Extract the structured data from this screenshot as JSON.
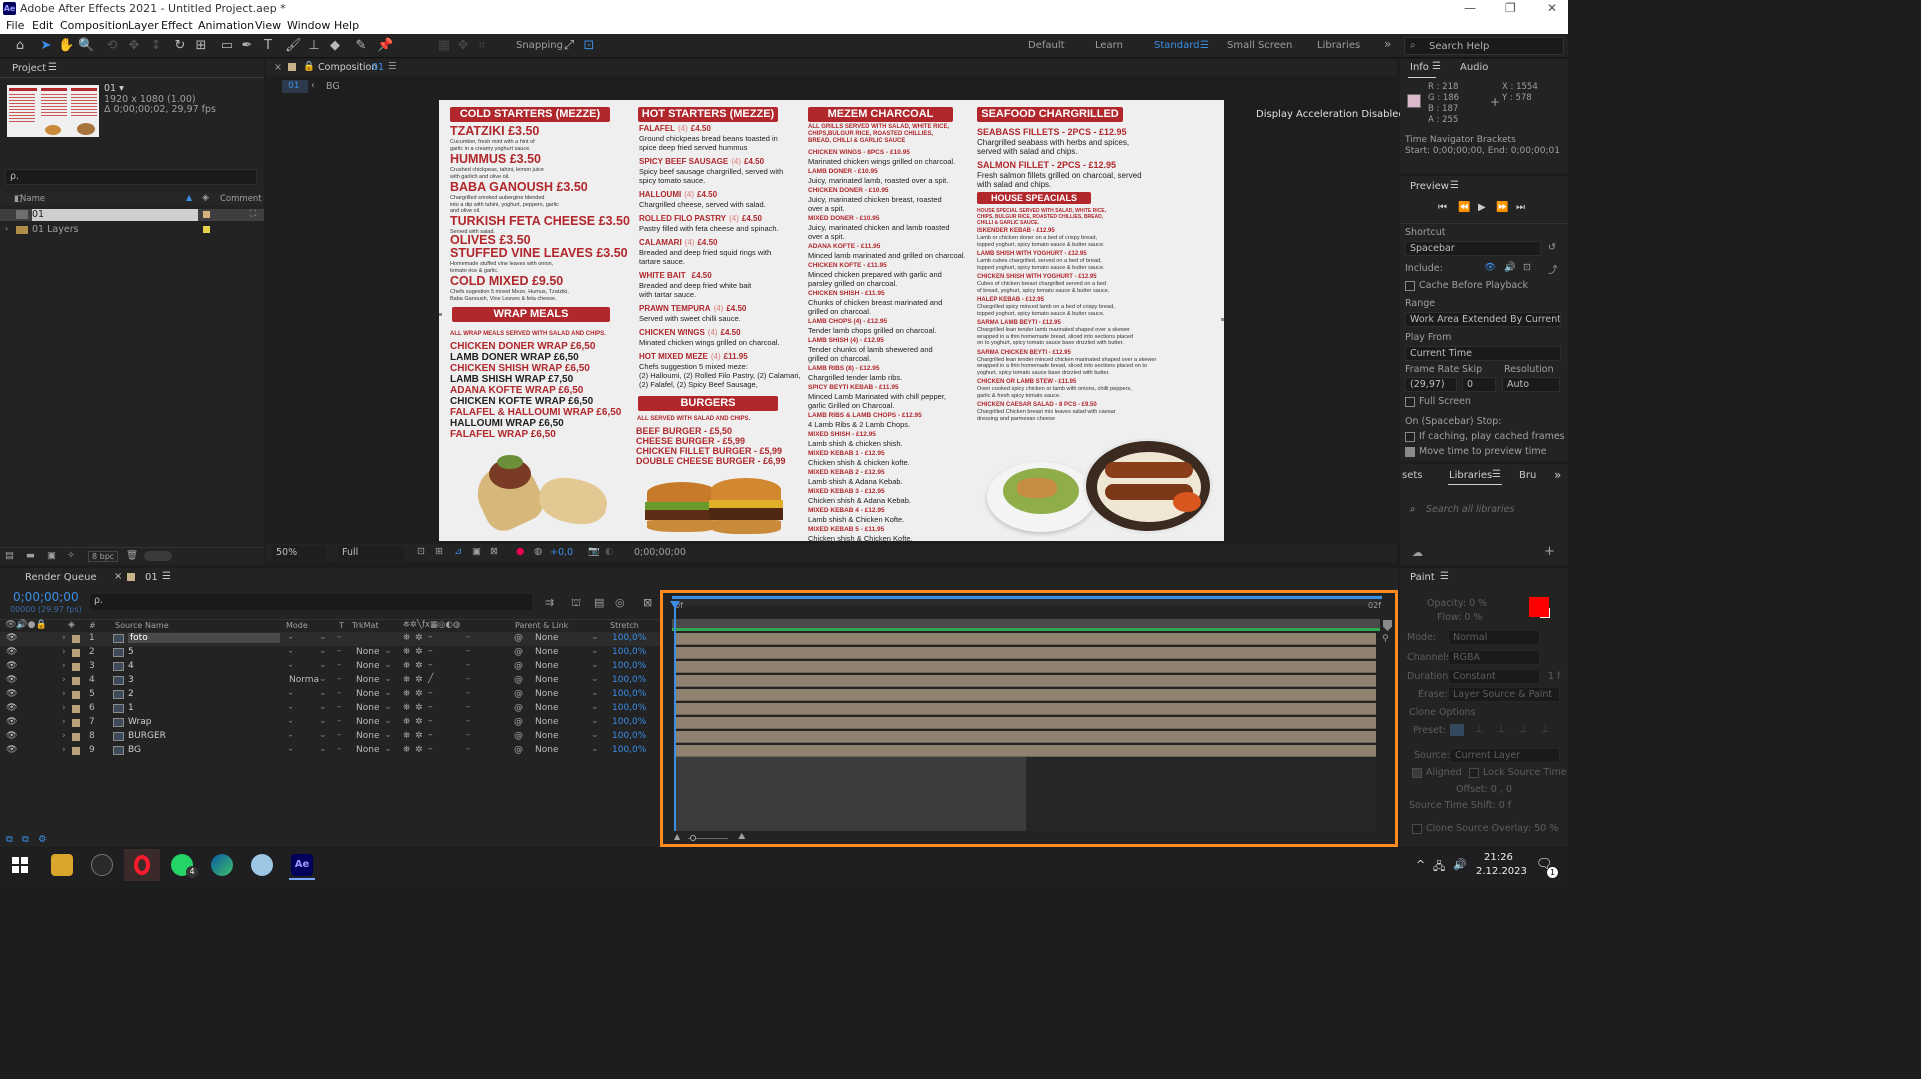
{
  "app": {
    "title": "Adobe After Effects 2021 - Untitled Project.aep *",
    "icon_text": "Ae"
  },
  "menu": [
    "File",
    "Edit",
    "Composition",
    "Layer",
    "Effect",
    "Animation",
    "View",
    "Window",
    "Help"
  ],
  "toolbar": {
    "snapping": "Snapping"
  },
  "workspaces": [
    "Default",
    "Learn",
    "Standard",
    "Small Screen",
    "Libraries"
  ],
  "search_help": "Search Help",
  "project": {
    "tab": "Project",
    "item_name": "01 ▾",
    "item_size": "1920 x 1080 (1.00)",
    "item_duration": "Δ 0;00;00;02, 29,97 fps",
    "search_placeholder": "ρ.",
    "col_name": "Name",
    "col_comment": "Comment",
    "items": [
      {
        "name": "01"
      },
      {
        "name": "01 Layers"
      }
    ],
    "bpc": "8 bpc"
  },
  "comp": {
    "tab_prefix": "Composition",
    "tab_name": "01",
    "crumb1": "01",
    "crumb2": "BG",
    "display_accel": "Display Acceleration Disabled",
    "zoom": "50%",
    "quality": "Full",
    "exposure": "+0,0",
    "timecode": "0;00;00;00"
  },
  "poster": {
    "cold": {
      "header": "COLD STARTERS (MEZZE)",
      "items": [
        {
          "name": "TZATZIKI £3.50",
          "desc": "Cucumber, fresh mint with a hint of|garlic in a creamy yoghurt sauce."
        },
        {
          "name": "HUMMUS £3.50",
          "desc": "Crushed chickpeas, tahini, lemon juice|with garlich and olive oil."
        },
        {
          "name": "BABA GANOUSH £3.50",
          "desc": "Chargrilled smoked aubergine blended|into a dip with tahini, yoghurt, peppers, garlic|and olive oil."
        },
        {
          "name": "TURKISH FETA CHEESE £3.50",
          "desc": "Served with salad."
        },
        {
          "name": "OLIVES £3.50",
          "desc": ""
        },
        {
          "name": "STUFFED VINE LEAVES £3.50",
          "desc": "Homemade stuffed vine leaves with onion,|tomato rice & garlic."
        },
        {
          "name": "COLD MIXED £9.50",
          "desc": "Chefs sugestion 5 mixed Meze, Humus, Tzatziki,|Baba Ganoush, Vine Leaves & feta cheese."
        }
      ]
    },
    "wrap": {
      "header": "WRAP MEALS",
      "note": "ALL WRAP MEALS SERVED WITH SALAD AND CHIPS.",
      "items": [
        "CHICKEN DONER WRAP £6,50",
        "LAMB DONER WRAP £6,50",
        "CHICKEN SHISH WRAP £6,50",
        "LAMB SHISH WRAP £7,50",
        "ADANA KOFTE WRAP £6,50",
        "CHICKEN KOFTE WRAP £6,50",
        "FALAFEL & HALLOUMI WRAP £6,50",
        "HALLOUMI WRAP £6,50",
        "FALAFEL WRAP £6,50"
      ]
    },
    "hot": {
      "header": "HOT STARTERS (MEZZE)",
      "items": [
        {
          "name": "FALAFEL",
          "qty": "(4)",
          "price": "£4.50",
          "desc": "Ground chickpeas bread beans toasted in|spice deep fried served hummus"
        },
        {
          "name": "SPICY BEEF SAUSAGE",
          "qty": "(4)",
          "price": "£4.50",
          "desc": "Spicy beef sausage chargrilled, served with|spicy tomato sauce."
        },
        {
          "name": "HALLOUMI",
          "qty": "(4)",
          "price": "£4.50",
          "desc": "Chargrilled cheese, served with salad."
        },
        {
          "name": "ROLLED FILO PASTRY",
          "qty": "(4)",
          "price": "£4.50",
          "desc": "Pastry filled with feta cheese and spinach."
        },
        {
          "name": "CALAMARI",
          "qty": "(4)",
          "price": "£4.50",
          "desc": "Breaded and deep fried squid rings with|tartare sauce."
        },
        {
          "name": "WHITE BAIT",
          "qty": "",
          "price": "£4.50",
          "desc": "Breaded and deep fried white bait|with tartar sauce."
        },
        {
          "name": "PRAWN TEMPURA",
          "qty": "(4)",
          "price": "£4.50",
          "desc": "Served with sweet chilli sauce."
        },
        {
          "name": "CHICKEN WINGS",
          "qty": "(4)",
          "price": "£4.50",
          "desc": "Minated chicken wings grilled on charcoal."
        },
        {
          "name": "HOT MIXED MEZE",
          "qty": "(4)",
          "price": "£11.95",
          "desc": "Chefs suggestion 5 mixed meze:|(2) Halloumi, (2) Rolled Filo Pastry, (2) Calamari,|(2) Falafel, (2) Spicy Beef Sausage,"
        }
      ]
    },
    "burgers": {
      "header": "BURGERS",
      "note": "ALL SERVED WITH SALAD AND CHIPS.",
      "items": [
        "BEEF BURGER - £5,50",
        "CHEESE BURGER - £5,99",
        "CHICKEN FILLET BURGER - £5,99",
        "DOUBLE CHEESE BURGER - £6,99"
      ]
    },
    "grills": {
      "header": "MEZEM CHARCOAL GRILLS",
      "note": "ALL GRILLS SERVED WITH SALAD, WHITE RICE,|CHIPS,BULGUR RICE, ROASTED CHILLIES,|BREAD, CHILLI & GARLIC SAUCE",
      "items": [
        {
          "name": "CHICKEN WINGS - 8PCS - £10.95",
          "desc": "Marinated chicken wings grilled on charcoal."
        },
        {
          "name": "LAMB DONER - £10.95",
          "desc": "Juicy, marinated lamb, roasted over a spit."
        },
        {
          "name": "CHICKEN DONER - £10.95",
          "desc": "Juicy, marinated chicken breast, roasted|over a spit."
        },
        {
          "name": "MIXED DONER - £10.95",
          "desc": "Juicy, marinated chicken and lamb roasted|over a spit."
        },
        {
          "name": "ADANA KOFTE - £11.95",
          "desc": "Minced lamb marinated and grilled on charcoal."
        },
        {
          "name": "CHICKEN KOFTE - £11.95",
          "desc": "Minced chicken prepared with garlic and|parsley grilled on charcoal."
        },
        {
          "name": "CHICKEN SHISH - £11.95",
          "desc": "Chunks of chicken breast marinated and|grilled on charcoal."
        },
        {
          "name": "LAMB CHOPS (4) - £12.95",
          "desc": "Tender lamb chops grilled on charcoal."
        },
        {
          "name": "LAMB SHISH (4) - £12.95",
          "desc": "Tender chunks of lamb shewered and|grilled on charcoal."
        },
        {
          "name": "LAMB RIBS (8) - £12.95",
          "desc": "Chargrilled tender lamb ribs."
        },
        {
          "name": "SPICY BEYTI KEBAB - £11.95",
          "desc": "Minced Lamb Marinated with chill pepper,|garlic Grilled on Charcoal."
        },
        {
          "name": "LAMB RIBS & LAMB CHOPS - £12.95",
          "desc": "4 Lamb Ribs & 2 Lamb Chops."
        },
        {
          "name": "MIXED SHISH - £12.95",
          "desc": "Lamb shish & chicken shish."
        },
        {
          "name": "MIXED KEBAB 1 - £12.95",
          "desc": "Chicken shish & chicken kofte."
        },
        {
          "name": "MIXED KEBAB 2 - £12.95",
          "desc": "Lamb shish & Adana Kebab."
        },
        {
          "name": "MIXED KEBAB 3 - £12.95",
          "desc": "Chicken shish & Adana Kebab."
        },
        {
          "name": "MIXED KEBAB 4 - £12.95",
          "desc": "Lamb shish & Chicken Kofte."
        },
        {
          "name": "MIXED KEBAB 5 - £11.95",
          "desc": "Chicken shish & Chicken Kofte."
        }
      ]
    },
    "seafood": {
      "header": "SEAFOOD CHARGRILLED",
      "items": [
        {
          "name": "SEABASS FILLETS - 2PCS - £12.95",
          "desc": "Chargrilled seabass with herbs and spices,|served with salad and chips."
        },
        {
          "name": "SALMON FILLET - 2PCS - £12.95",
          "desc": "Fresh salmon fillets grilled on charcoal, served|with salad and chips."
        }
      ]
    },
    "specials": {
      "header": "HOUSE SPEACIALS",
      "note": "HOUSE SPECIAL SERVED WITH SALAD, WHITE RICE,|CHIPS, BULGUR RICE, ROASTED CHILLIES, BREAD,|CHILLI & GARLIC SAUCE.",
      "items": [
        {
          "name": "ISKENDER KEBAB - £12.95",
          "desc": "Lamb or chicken doner on a bed of crispy bread,|topped yoghurt, spicy tomato sauce & butter sauce."
        },
        {
          "name": "LAMB SHISH WITH YOGHURT - £12.95",
          "desc": "Lamb cubes chargrilled, served on a bed of bread,|topped yoghurt, spicy tomato sauce & butter sauce."
        },
        {
          "name": "CHICKEN SHISH WITH YOGHURT - £12.95",
          "desc": "Cubes of chicken breast chargrilled served on a bed|of bread, yoghurt, spicy tomato sauce & butter sauce."
        },
        {
          "name": "HALEP KEBAB - £12.95",
          "desc": "Chargrilled spicy minced lamb on a bed of crispy bread,|topped yoghurt, spicy tomato sauce & butter sauce."
        },
        {
          "name": "SARMA LAMB BEYTI - £12.95",
          "desc": "Chargrilled lean tender lamb marinated shaped over a skewer|wrapped in a thin homemade bread, sliced into sections placed|on to yoghurt, spicy tomato sauce base drizzled with butter."
        },
        {
          "name": "SARMA CHICKEN BEYTI - £12.95",
          "desc": "Chargrilled lean tender minced chicken marinated shaped over a skewer|wrapped in a thin homemade bread, sliced into sections placed on to|yoghurt, spicy tomato sauce base drizzled with butter."
        },
        {
          "name": "CHICKEN OR LAMB STEW - £11.95",
          "desc": "Oven cooked spicy chicken or lamb with onions, chilli peppers,|garlic & fresh spicy tomato sauce."
        },
        {
          "name": "CHICKEN CAESAR SALAD - 8 PCS - £9.50",
          "desc": "Chargrilled Chicken breast mix leaves salad with caesar|dressing and parmesan cheese"
        }
      ]
    }
  },
  "info": {
    "tab": "Info",
    "tab2": "Audio",
    "r": "R : 218",
    "g": "G : 186",
    "b": "B : 187",
    "a": "A : 255",
    "x": "X : 1554",
    "y": "Y : 578",
    "color": "#dabaca",
    "navtitle": "Time Navigator Brackets",
    "navrange": "Start: 0;00;00;00, End: 0;00;00;01"
  },
  "preview": {
    "tab": "Preview",
    "shortcut_label": "Shortcut",
    "shortcut": "Spacebar",
    "include_label": "Include:",
    "cache": "Cache Before Playback",
    "range_label": "Range",
    "range": "Work Area Extended By Current...",
    "playfrom_label": "Play From",
    "playfrom": "Current Time",
    "framerate_label": "Frame Rate",
    "skip_label": "Skip",
    "resolution_label": "Resolution",
    "framerate": "(29,97)",
    "skip": "0",
    "resolution": "Auto",
    "fullscreen": "Full Screen",
    "onstop": "On (Spacebar) Stop:",
    "ifcaching": "If caching, play cached frames",
    "movetime": "Move time to preview time"
  },
  "libraries": {
    "tab0": "sets",
    "tab": "Libraries",
    "tab2": "Bru",
    "search": "Search all libraries"
  },
  "paint": {
    "tab": "Paint",
    "opacity": "Opacity: 0 %",
    "flow": "Flow: 0 %",
    "mode_label": "Mode:",
    "mode": "Normal",
    "channels_label": "Channels:",
    "channels": "RGBA",
    "duration_label": "Duration:",
    "duration": "Constant",
    "duration_val": "1 f",
    "erase_label": "Erase:",
    "erase": "Layer Source & Paint",
    "clone": "Clone Options",
    "preset": "Preset:",
    "source_label": "Source:",
    "source": "Current Layer",
    "aligned": "Aligned",
    "lock": "Lock Source Time",
    "offset": "Offset: 0 , 0",
    "shift": "Source Time Shift: 0 f",
    "overlay": "Clone Source Overlay: 50 %",
    "fg": "#ff0000",
    "bg": "#ffffff"
  },
  "timeline": {
    "tab_render": "Render Queue",
    "tab_comp": "01",
    "timecode": "0;00;00;00",
    "timecode_sub": "00000 (29.97 fps)",
    "search_placeholder": "ρ.",
    "col_hash": "#",
    "col_source": "Source Name",
    "col_mode": "Mode",
    "col_t": "T",
    "col_trkmat": "TrkMat",
    "col_parent": "Parent & Link",
    "col_stretch": "Stretch",
    "ruler_start": "0f",
    "ruler_end": "02f",
    "layers": [
      {
        "num": "1",
        "name": "foto",
        "mode": "-",
        "trk": "",
        "parent": "None",
        "stretch": "100,0%"
      },
      {
        "num": "2",
        "name": "5",
        "mode": "-",
        "trk": "None",
        "parent": "None",
        "stretch": "100,0%"
      },
      {
        "num": "3",
        "name": "4",
        "mode": "-",
        "trk": "None",
        "parent": "None",
        "stretch": "100,0%"
      },
      {
        "num": "4",
        "name": "3",
        "mode": "Norma",
        "trk": "None",
        "parent": "None",
        "stretch": "100,0%"
      },
      {
        "num": "5",
        "name": "2",
        "mode": "-",
        "trk": "None",
        "parent": "None",
        "stretch": "100,0%"
      },
      {
        "num": "6",
        "name": "1",
        "mode": "-",
        "trk": "None",
        "parent": "None",
        "stretch": "100,0%"
      },
      {
        "num": "7",
        "name": "Wrap",
        "mode": "-",
        "trk": "None",
        "parent": "None",
        "stretch": "100,0%"
      },
      {
        "num": "8",
        "name": "BURGER",
        "mode": "-",
        "trk": "None",
        "parent": "None",
        "stretch": "100,0%"
      },
      {
        "num": "9",
        "name": "BG",
        "mode": "-",
        "trk": "None",
        "parent": "None",
        "stretch": "100,0%"
      }
    ]
  },
  "taskbar": {
    "time": "21:26",
    "date": "2.12.2023",
    "whatsapp_badge": "4",
    "ae_icon": "Ae",
    "notif_badge": "1"
  },
  "colors": {
    "accent": "#3a8ee6",
    "highlight": "#ff8a1f",
    "brand_red": "#b1272c",
    "layer_bar": "#8f8271"
  }
}
